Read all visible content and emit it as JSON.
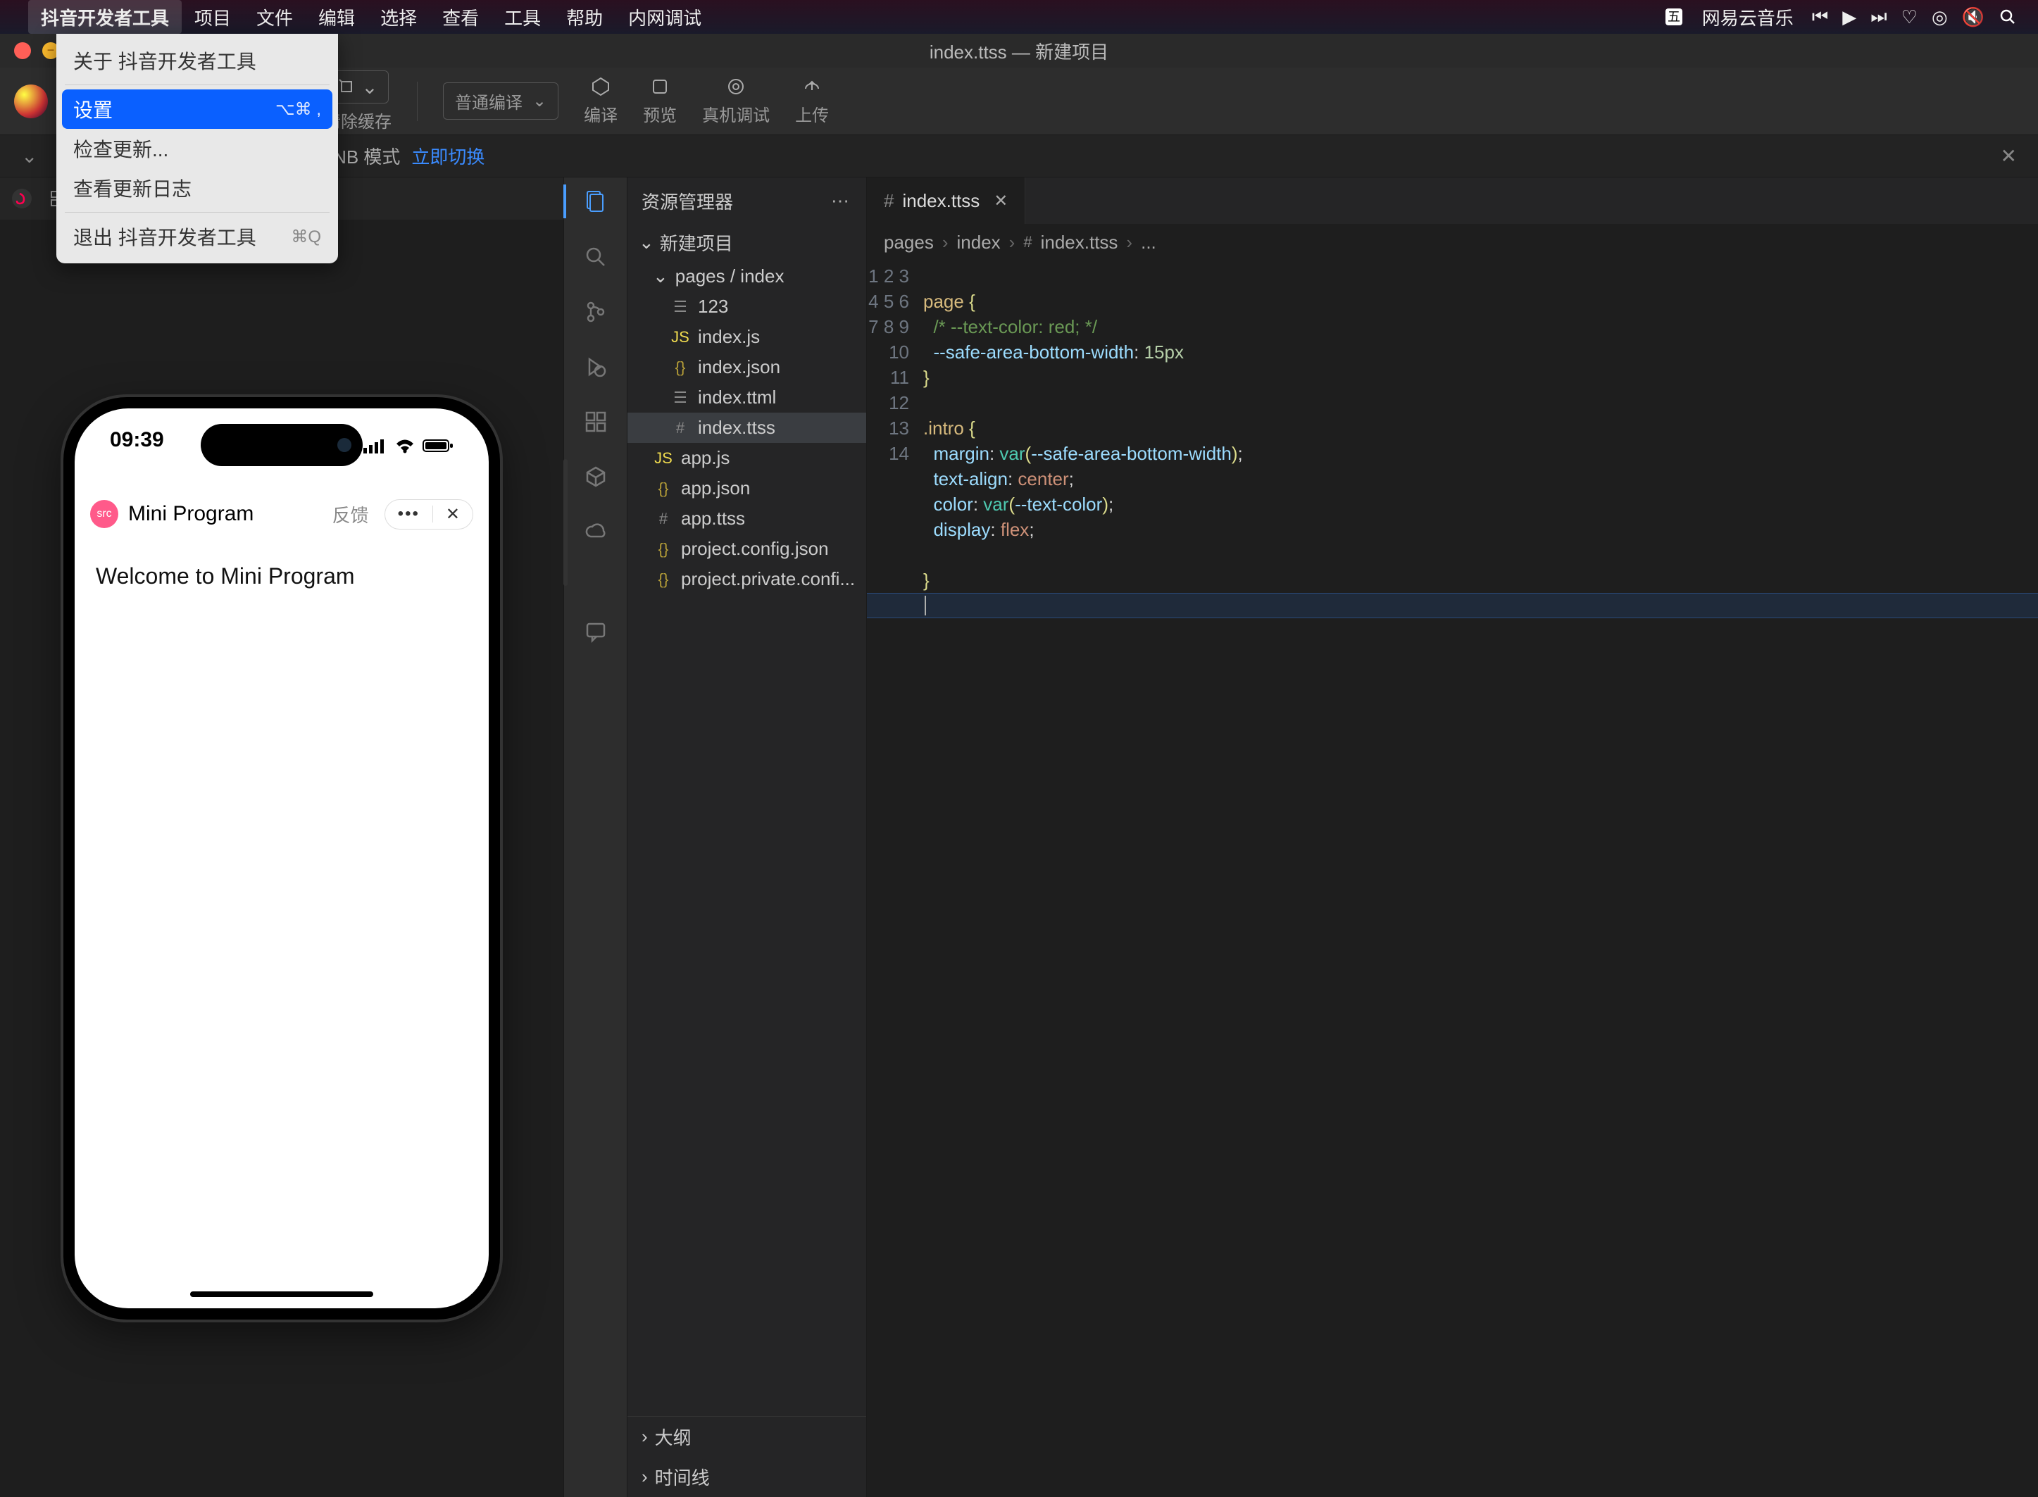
{
  "menubar": {
    "app_name": "抖音开发者工具",
    "items": [
      "项目",
      "文件",
      "编辑",
      "选择",
      "查看",
      "工具",
      "帮助",
      "内网调试"
    ],
    "status_right": "网易云音乐"
  },
  "dropdown": {
    "about": "关于 抖音开发者工具",
    "settings": "设置",
    "settings_shortcut": "⌥⌘ ,",
    "check_update": "检查更新...",
    "view_log": "查看更新日志",
    "quit": "退出 抖音开发者工具",
    "quit_shortcut": "⌘Q"
  },
  "titlebar": {
    "title": "index.ttss — 新建项目"
  },
  "toolbar": {
    "clear_cache": "清除缓存",
    "compile_mode": "普通编译",
    "compile": "编译",
    "preview": "预览",
    "remote_debug": "真机调试",
    "upload": "上传"
  },
  "hint": {
    "text_partial": "若只需要音视频能力 可考虑 CNB 模式",
    "link": "立即切换"
  },
  "simulator": {
    "time": "09:39",
    "app_title": "Mini Program",
    "feedback": "反馈",
    "body_text": "Welcome to Mini Program"
  },
  "explorer": {
    "title": "资源管理器",
    "root": "新建项目",
    "folder": "pages / index",
    "files": [
      {
        "name": "123",
        "icon": "lines"
      },
      {
        "name": "index.js",
        "icon": "js"
      },
      {
        "name": "index.json",
        "icon": "json"
      },
      {
        "name": "index.ttml",
        "icon": "lines"
      },
      {
        "name": "index.ttss",
        "icon": "hash",
        "selected": true
      },
      {
        "name": "app.js",
        "icon": "js",
        "depth": 1
      },
      {
        "name": "app.json",
        "icon": "json",
        "depth": 1
      },
      {
        "name": "app.ttss",
        "icon": "hash",
        "depth": 1
      },
      {
        "name": "project.config.json",
        "icon": "json",
        "depth": 1
      },
      {
        "name": "project.private.confi...",
        "icon": "json",
        "depth": 1
      }
    ],
    "footer": {
      "outline": "大纲",
      "timeline": "时间线"
    }
  },
  "editor": {
    "tab_name": "index.ttss",
    "breadcrumb": [
      "pages",
      "index",
      "index.ttss",
      "..."
    ],
    "lines": 14
  },
  "code_tokens": {
    "l2_sel": "page ",
    "l2_b": "{",
    "l3_comment": "/* --text-color: red; */",
    "l4_prop": "--safe-area-bottom-width",
    "l4_val": "15px",
    "l5_b": "}",
    "l7_sel": ".intro ",
    "l7_b": "{",
    "l8_prop": "margin",
    "l8_func": "var",
    "l8_var": "--safe-area-bottom-width",
    "l9_prop": "text-align",
    "l9_val": "center",
    "l10_prop": "color",
    "l10_func": "var",
    "l10_var": "--text-color",
    "l11_prop": "display",
    "l11_val": "flex",
    "l13_b": "}"
  }
}
